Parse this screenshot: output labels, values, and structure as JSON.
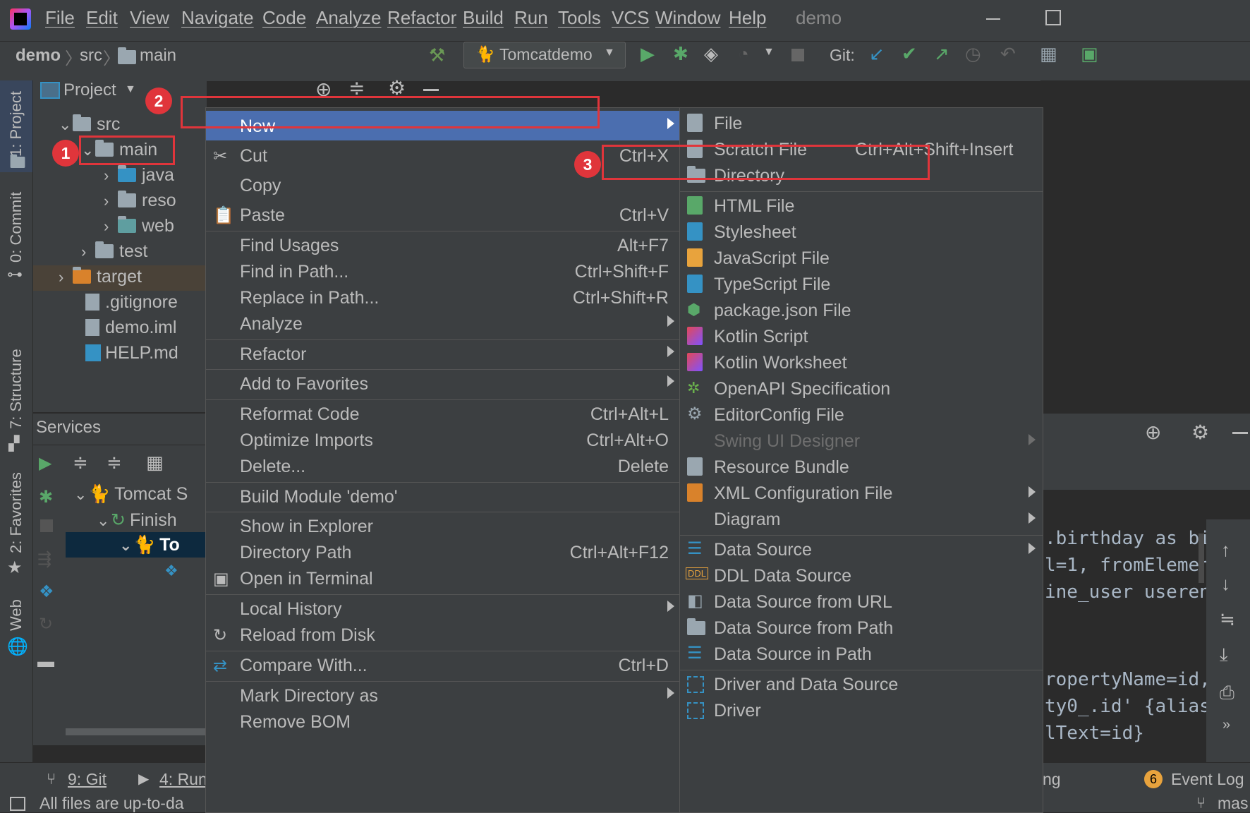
{
  "menubar": {
    "items": [
      "File",
      "Edit",
      "View",
      "Navigate",
      "Code",
      "Analyze",
      "Refactor",
      "Build",
      "Run",
      "Tools",
      "VCS",
      "Window",
      "Help"
    ],
    "project_name": "demo"
  },
  "toolbar": {
    "breadcrumb": [
      "demo",
      "src",
      "main"
    ],
    "run_config": "Tomcatdemo",
    "git_label": "Git:"
  },
  "left_strip": {
    "project": "1: Project",
    "commit": "0: Commit",
    "structure": "7: Structure",
    "favorites": "2: Favorites",
    "web": "Web"
  },
  "project_panel": {
    "title": "Project",
    "tree": [
      {
        "label": "src",
        "kind": "folder"
      },
      {
        "label": "main",
        "kind": "folder"
      },
      {
        "label": "java",
        "kind": "folder"
      },
      {
        "label": "reso",
        "kind": "folder"
      },
      {
        "label": "web",
        "kind": "folder"
      },
      {
        "label": "test",
        "kind": "folder"
      },
      {
        "label": "target",
        "kind": "folder-orange"
      },
      {
        "label": ".gitignore",
        "kind": "file"
      },
      {
        "label": "demo.iml",
        "kind": "file"
      },
      {
        "label": "HELP.md",
        "kind": "file"
      }
    ]
  },
  "services_panel": {
    "title": "Services",
    "tree": [
      "Tomcat S",
      "Finish",
      "To"
    ]
  },
  "context_menu": {
    "items": [
      {
        "label": "New",
        "shortcut": "",
        "submenu": true
      },
      {
        "label": "Cut",
        "shortcut": "Ctrl+X",
        "icon": "cut-icon"
      },
      {
        "label": "Copy",
        "shortcut": ""
      },
      {
        "label": "Paste",
        "shortcut": "Ctrl+V",
        "icon": "paste-icon"
      },
      {
        "label": "Find Usages",
        "shortcut": "Alt+F7"
      },
      {
        "label": "Find in Path...",
        "shortcut": "Ctrl+Shift+F"
      },
      {
        "label": "Replace in Path...",
        "shortcut": "Ctrl+Shift+R"
      },
      {
        "label": "Analyze",
        "shortcut": "",
        "submenu": true
      },
      {
        "label": "Refactor",
        "shortcut": "",
        "submenu": true
      },
      {
        "label": "Add to Favorites",
        "shortcut": "",
        "submenu": true
      },
      {
        "label": "Reformat Code",
        "shortcut": "Ctrl+Alt+L"
      },
      {
        "label": "Optimize Imports",
        "shortcut": "Ctrl+Alt+O"
      },
      {
        "label": "Delete...",
        "shortcut": "Delete"
      },
      {
        "label": "Build Module 'demo'",
        "shortcut": ""
      },
      {
        "label": "Show in Explorer",
        "shortcut": ""
      },
      {
        "label": "Directory Path",
        "shortcut": "Ctrl+Alt+F12"
      },
      {
        "label": "Open in Terminal",
        "shortcut": "",
        "icon": "terminal-icon"
      },
      {
        "label": "Local History",
        "shortcut": "",
        "submenu": true
      },
      {
        "label": "Reload from Disk",
        "shortcut": "",
        "icon": "reload-icon"
      },
      {
        "label": "Compare With...",
        "shortcut": "Ctrl+D",
        "icon": "compare-icon"
      },
      {
        "label": "Mark Directory as",
        "shortcut": "",
        "submenu": true
      },
      {
        "label": "Remove BOM",
        "shortcut": ""
      }
    ]
  },
  "new_submenu": {
    "items": [
      {
        "label": "File",
        "shortcut": ""
      },
      {
        "label": "Scratch File",
        "shortcut": "Ctrl+Alt+Shift+Insert"
      },
      {
        "label": "Directory",
        "shortcut": ""
      },
      {
        "label": "HTML File",
        "shortcut": ""
      },
      {
        "label": "Stylesheet",
        "shortcut": ""
      },
      {
        "label": "JavaScript File",
        "shortcut": ""
      },
      {
        "label": "TypeScript File",
        "shortcut": ""
      },
      {
        "label": "package.json File",
        "shortcut": ""
      },
      {
        "label": "Kotlin Script",
        "shortcut": ""
      },
      {
        "label": "Kotlin Worksheet",
        "shortcut": ""
      },
      {
        "label": "OpenAPI Specification",
        "shortcut": ""
      },
      {
        "label": "EditorConfig File",
        "shortcut": ""
      },
      {
        "label": "Swing UI Designer",
        "shortcut": "",
        "disabled": true,
        "submenu": true
      },
      {
        "label": "Resource Bundle",
        "shortcut": ""
      },
      {
        "label": "XML Configuration File",
        "shortcut": "",
        "submenu": true
      },
      {
        "label": "Diagram",
        "shortcut": "",
        "submenu": true
      },
      {
        "label": "Data Source",
        "shortcut": "",
        "submenu": true
      },
      {
        "label": "DDL Data Source",
        "shortcut": ""
      },
      {
        "label": "Data Source from URL",
        "shortcut": ""
      },
      {
        "label": "Data Source from Path",
        "shortcut": ""
      },
      {
        "label": "Data Source in Path",
        "shortcut": ""
      },
      {
        "label": "Driver and Data Source",
        "shortcut": ""
      },
      {
        "label": "Driver",
        "shortcut": ""
      }
    ]
  },
  "console": {
    "lines": [
      ".birthday as bi",
      "l=1, fromElemen",
      "ine_user useren",
      "",
      "",
      "ropertyName=id,",
      "ty0_.id' {alias",
      "lText=id}"
    ]
  },
  "annotations": {
    "badges": [
      "1",
      "2",
      "3"
    ]
  },
  "statusbar": {
    "git_tab": "9: Git",
    "run_tab": "4: Run",
    "message": "All files are up-to-da",
    "event_count": "6",
    "event_log": "Event Log",
    "branch": "mas",
    "ng_fragment": "ng"
  },
  "colors": {
    "accent_selected": "#4b6eaf",
    "annotation_red": "#e0353b",
    "panel_bg": "#3c3f41"
  }
}
